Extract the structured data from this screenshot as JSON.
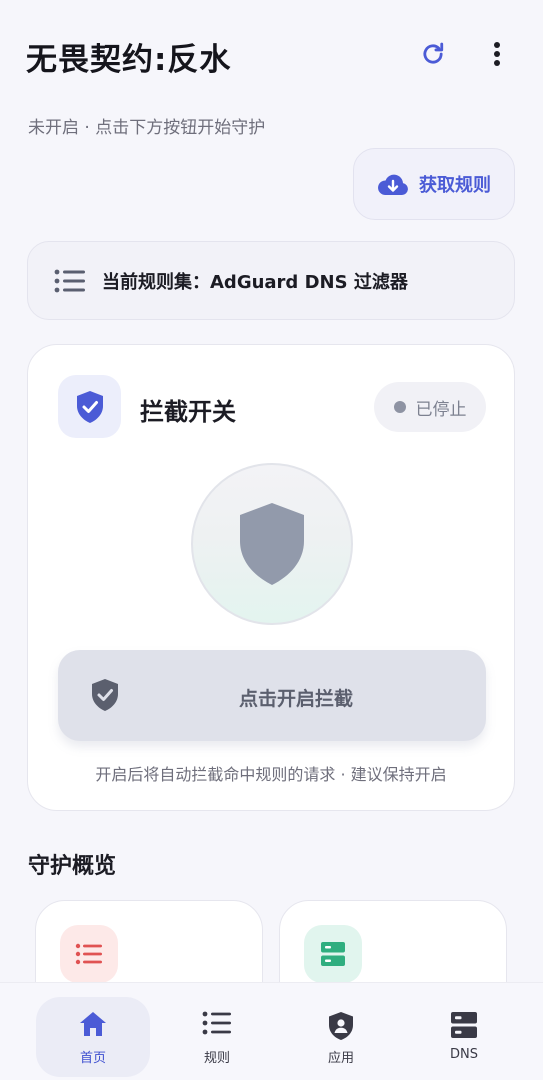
{
  "header": {
    "title": "无畏契约:反水",
    "subtitle": "未开启 · 点击下方按钮开始守护",
    "refresh_icon": "refresh-icon",
    "more_icon": "more-vertical-icon"
  },
  "fetch_rules": {
    "label": "获取规则",
    "icon": "cloud-download-icon"
  },
  "ruleset": {
    "label": "当前规则集：AdGuard DNS 过滤器",
    "icon": "list-icon"
  },
  "switch_card": {
    "title": "拦截开关",
    "status": "已停止",
    "button_label": "点击开启拦截",
    "hint": "开启后将自动拦截命中规则的请求 · 建议保持开启"
  },
  "overview": {
    "title": "守护概览"
  },
  "nav": [
    {
      "label": "首页",
      "icon": "home-icon",
      "active": true
    },
    {
      "label": "规则",
      "icon": "list-icon",
      "active": false
    },
    {
      "label": "应用",
      "icon": "shield-user-icon",
      "active": false
    },
    {
      "label": "DNS",
      "icon": "server-icon",
      "active": false
    }
  ],
  "colors": {
    "accent": "#4b5bd6",
    "status_stopped": "#8e93a3",
    "overview_red": "#e05252",
    "overview_green": "#2fae7f"
  }
}
